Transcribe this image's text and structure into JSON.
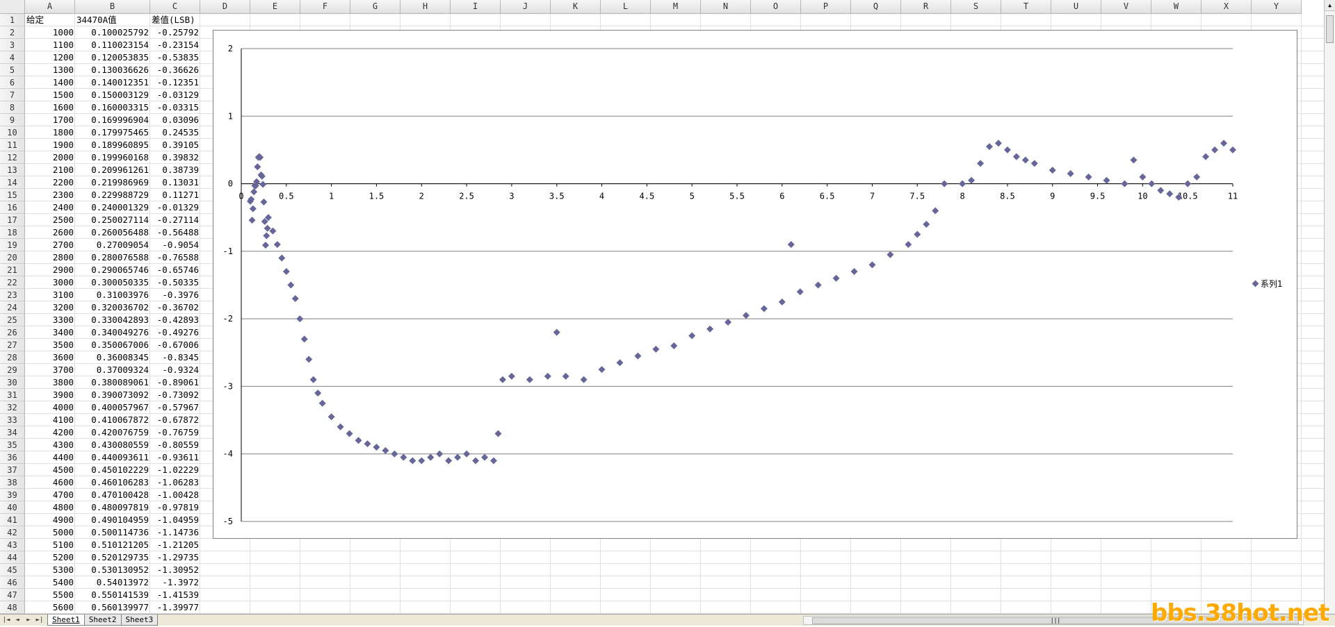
{
  "spreadsheet": {
    "columns": [
      "A",
      "B",
      "C",
      "D",
      "E",
      "F",
      "G",
      "H",
      "I",
      "J",
      "K",
      "L",
      "M",
      "N",
      "O",
      "P",
      "Q",
      "R",
      "S",
      "T",
      "U",
      "V",
      "W",
      "X",
      "Y"
    ],
    "rows": [
      [
        "给定",
        "34470A值",
        "差值(LSB)"
      ],
      [
        "1000",
        "0.100025792",
        "-0.25792"
      ],
      [
        "1100",
        "0.110023154",
        "-0.23154"
      ],
      [
        "1200",
        "0.120053835",
        "-0.53835"
      ],
      [
        "1300",
        "0.130036626",
        "-0.36626"
      ],
      [
        "1400",
        "0.140012351",
        "-0.12351"
      ],
      [
        "1500",
        "0.150003129",
        "-0.03129"
      ],
      [
        "1600",
        "0.160003315",
        "-0.03315"
      ],
      [
        "1700",
        "0.169996904",
        "0.03096"
      ],
      [
        "1800",
        "0.179975465",
        "0.24535"
      ],
      [
        "1900",
        "0.189960895",
        "0.39105"
      ],
      [
        "2000",
        "0.199960168",
        "0.39832"
      ],
      [
        "2100",
        "0.209961261",
        "0.38739"
      ],
      [
        "2200",
        "0.219986969",
        "0.13031"
      ],
      [
        "2300",
        "0.229988729",
        "0.11271"
      ],
      [
        "2400",
        "0.240001329",
        "-0.01329"
      ],
      [
        "2500",
        "0.250027114",
        "-0.27114"
      ],
      [
        "2600",
        "0.260056488",
        "-0.56488"
      ],
      [
        "2700",
        "0.27009054",
        "-0.9054"
      ],
      [
        "2800",
        "0.280076588",
        "-0.76588"
      ],
      [
        "2900",
        "0.290065746",
        "-0.65746"
      ],
      [
        "3000",
        "0.300050335",
        "-0.50335"
      ],
      [
        "3100",
        "0.31003976",
        "-0.3976"
      ],
      [
        "3200",
        "0.320036702",
        "-0.36702"
      ],
      [
        "3300",
        "0.330042893",
        "-0.42893"
      ],
      [
        "3400",
        "0.340049276",
        "-0.49276"
      ],
      [
        "3500",
        "0.350067006",
        "-0.67006"
      ],
      [
        "3600",
        "0.36008345",
        "-0.8345"
      ],
      [
        "3700",
        "0.37009324",
        "-0.9324"
      ],
      [
        "3800",
        "0.380089061",
        "-0.89061"
      ],
      [
        "3900",
        "0.390073092",
        "-0.73092"
      ],
      [
        "4000",
        "0.400057967",
        "-0.57967"
      ],
      [
        "4100",
        "0.410067872",
        "-0.67872"
      ],
      [
        "4200",
        "0.420076759",
        "-0.76759"
      ],
      [
        "4300",
        "0.430080559",
        "-0.80559"
      ],
      [
        "4400",
        "0.440093611",
        "-0.93611"
      ],
      [
        "4500",
        "0.450102229",
        "-1.02229"
      ],
      [
        "4600",
        "0.460106283",
        "-1.06283"
      ],
      [
        "4700",
        "0.470100428",
        "-1.00428"
      ],
      [
        "4800",
        "0.480097819",
        "-0.97819"
      ],
      [
        "4900",
        "0.490104959",
        "-1.04959"
      ],
      [
        "5000",
        "0.500114736",
        "-1.14736"
      ],
      [
        "5100",
        "0.510121205",
        "-1.21205"
      ],
      [
        "5200",
        "0.520129735",
        "-1.29735"
      ],
      [
        "5300",
        "0.530130952",
        "-1.30952"
      ],
      [
        "5400",
        "0.54013972",
        "-1.3972"
      ],
      [
        "5500",
        "0.550141539",
        "-1.41539"
      ],
      [
        "5600",
        "0.560139977",
        "-1.39977"
      ]
    ]
  },
  "sheet_tabs": [
    "Sheet1",
    "Sheet2",
    "Sheet3"
  ],
  "nav_buttons": [
    "|◄",
    "◄",
    "►",
    "►|"
  ],
  "watermark": "bbs.38hot.net",
  "colors": {
    "marker": "#666699",
    "gridline": "#7f7f7f",
    "watermark": "#ffaa00"
  },
  "chart_data": {
    "type": "scatter",
    "title": "",
    "xlabel": "",
    "ylabel": "",
    "xlim": [
      0,
      11
    ],
    "ylim": [
      -5,
      2
    ],
    "xticks": [
      "0",
      "0.5",
      "1",
      "1.5",
      "2",
      "2.5",
      "3",
      "3.5",
      "4",
      "4.5",
      "5",
      "5.5",
      "6",
      "6.5",
      "7",
      "7.5",
      "8",
      "8.5",
      "9",
      "9.5",
      "10",
      "10.5",
      "11"
    ],
    "yticks": [
      "2",
      "1",
      "0",
      "-1",
      "-2",
      "-3",
      "-4",
      "-5"
    ],
    "grid": "horizontal major gridlines",
    "legend": "right",
    "series": [
      {
        "name": "系列1",
        "x": [
          0.1,
          0.11,
          0.12,
          0.13,
          0.14,
          0.15,
          0.16,
          0.17,
          0.18,
          0.19,
          0.2,
          0.21,
          0.22,
          0.23,
          0.24,
          0.25,
          0.26,
          0.27,
          0.28,
          0.29,
          0.3,
          0.35,
          0.4,
          0.45,
          0.5,
          0.55,
          0.6,
          0.65,
          0.7,
          0.75,
          0.8,
          0.85,
          0.9,
          1.0,
          1.1,
          1.2,
          1.3,
          1.4,
          1.5,
          1.6,
          1.7,
          1.8,
          1.9,
          2.0,
          2.1,
          2.2,
          2.3,
          2.4,
          2.5,
          2.6,
          2.7,
          2.8,
          2.85,
          2.9,
          3.0,
          3.2,
          3.4,
          3.5,
          3.6,
          3.8,
          4.0,
          4.2,
          4.4,
          4.6,
          4.8,
          5.0,
          5.2,
          5.4,
          5.6,
          5.8,
          6.0,
          6.1,
          6.2,
          6.4,
          6.6,
          6.8,
          7.0,
          7.2,
          7.4,
          7.5,
          7.6,
          7.7,
          7.8,
          8.0,
          8.1,
          8.2,
          8.3,
          8.4,
          8.5,
          8.6,
          8.7,
          8.8,
          9.0,
          9.2,
          9.4,
          9.6,
          9.8,
          9.9,
          10.0,
          10.1,
          10.2,
          10.3,
          10.4,
          10.5,
          10.6,
          10.7,
          10.8,
          10.9,
          11.0
        ],
        "y": [
          -0.26,
          -0.23,
          -0.54,
          -0.37,
          -0.12,
          -0.03,
          -0.03,
          0.03,
          0.25,
          0.39,
          0.4,
          0.39,
          0.13,
          0.11,
          -0.01,
          -0.27,
          -0.56,
          -0.91,
          -0.77,
          -0.66,
          -0.5,
          -0.7,
          -0.9,
          -1.1,
          -1.3,
          -1.5,
          -1.7,
          -2.0,
          -2.3,
          -2.6,
          -2.9,
          -3.1,
          -3.25,
          -3.45,
          -3.6,
          -3.7,
          -3.8,
          -3.85,
          -3.9,
          -3.95,
          -4.0,
          -4.05,
          -4.1,
          -4.1,
          -4.05,
          -4.0,
          -4.1,
          -4.05,
          -4.0,
          -4.1,
          -4.05,
          -4.1,
          -3.7,
          -2.9,
          -2.85,
          -2.9,
          -2.85,
          -2.2,
          -2.85,
          -2.9,
          -2.75,
          -2.65,
          -2.55,
          -2.45,
          -2.4,
          -2.25,
          -2.15,
          -2.05,
          -1.95,
          -1.85,
          -1.75,
          -0.9,
          -1.6,
          -1.5,
          -1.4,
          -1.3,
          -1.2,
          -1.05,
          -0.9,
          -0.75,
          -0.6,
          -0.4,
          0.0,
          0.0,
          0.05,
          0.3,
          0.55,
          0.6,
          0.5,
          0.4,
          0.35,
          0.3,
          0.2,
          0.15,
          0.1,
          0.05,
          0.0,
          0.35,
          0.1,
          0.0,
          -0.1,
          -0.15,
          -0.2,
          0.0,
          0.1,
          0.4,
          0.5,
          0.6,
          0.5
        ]
      }
    ]
  }
}
